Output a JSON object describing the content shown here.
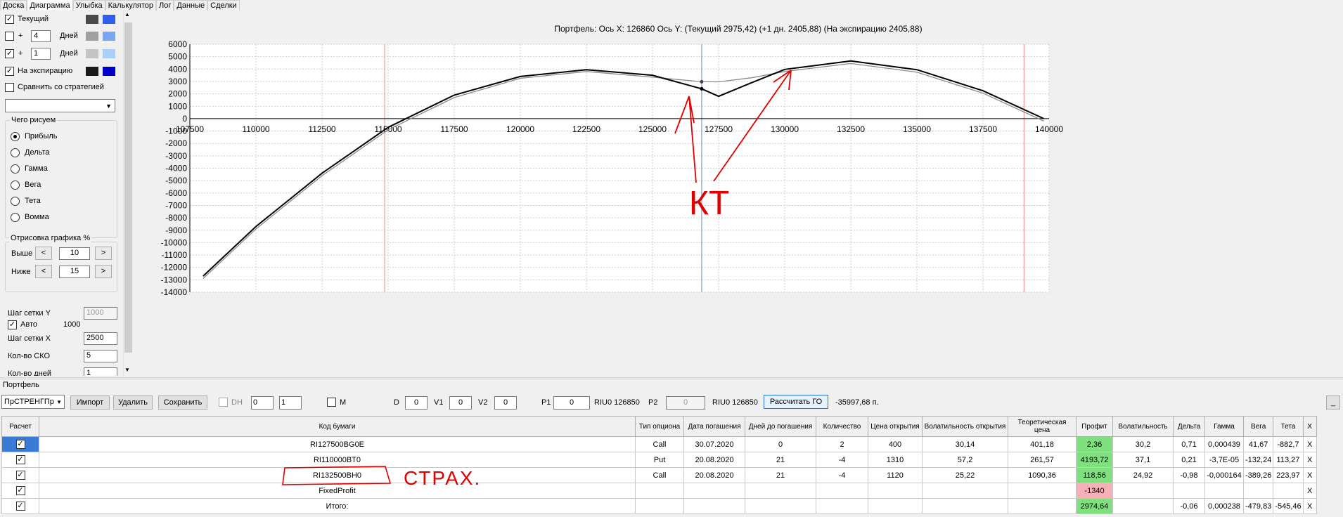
{
  "tabs": [
    "Доска",
    "Диаграмма",
    "Улыбка",
    "Калькулятор",
    "Лог",
    "Данные",
    "Сделки"
  ],
  "left": {
    "tekushiy_label": "Текущий",
    "plus1": "+",
    "days1_value": "4",
    "days1_label": "Дней",
    "plus2": "+",
    "days2_value": "1",
    "days2_label": "Дней",
    "expir_label": "На экспирацию",
    "compare_label": "Сравнить со стратегией",
    "draw_group": "Чего рисуем",
    "options": [
      "Прибыль",
      "Дельта",
      "Гамма",
      "Вега",
      "Тета",
      "Вомма"
    ],
    "render_group": "Отрисовка графика %",
    "higher_label": "Выше",
    "higher_value": "10",
    "lower_label": "Ниже",
    "lower_value": "15",
    "btn_left": "<",
    "btn_right": ">",
    "grid_y_label": "Шаг сетки Y",
    "grid_y_value": "1000",
    "auto_label": "Авто",
    "auto_value": "1000",
    "grid_x_label": "Шаг сетки X",
    "grid_x_value": "2500",
    "sko_label": "Кол-во СКО",
    "sko_value": "5",
    "days_cut_label": "Кол-во дней",
    "days_cut_value": "1"
  },
  "colors": {
    "current": "#4a4a4a",
    "current2": "#2f5ff0",
    "d1": "#a0a0a0",
    "d1b": "#7aa6f0",
    "d2": "#c4c4c4",
    "d2b": "#a8d0f8",
    "exp": "#1a1a1a",
    "expb": "#0000c8",
    "annot": "#e00000"
  },
  "chart_data": {
    "type": "line",
    "title": "Портфель: Ось X: 126860 Ось Y:  (Текущий 2975,42)  (+1 дн. 2405,88)  (На экспирацию 2405,88)",
    "xlim": [
      107500,
      140000
    ],
    "ylim": [
      -14000,
      6000
    ],
    "x_ticks": [
      107500,
      110000,
      112500,
      115000,
      117500,
      120000,
      122500,
      125000,
      127500,
      130000,
      132500,
      135000,
      137500,
      140000
    ],
    "y_ticks": [
      6000,
      5000,
      4000,
      3000,
      2000,
      1000,
      0,
      -1000,
      -2000,
      -3000,
      -4000,
      -5000,
      -6000,
      -7000,
      -8000,
      -9000,
      -10000,
      -11000,
      -12000,
      -13000,
      -14000
    ],
    "cursor_x": 126860,
    "red_lines": [
      114870,
      139050
    ],
    "series": [
      {
        "x": [
          108000,
          110000,
          112500,
          115000,
          117500,
          120000,
          122500,
          125000,
          126860,
          127500,
          128750,
          130000,
          132500,
          135000,
          137500,
          139800
        ],
        "y": [
          -12700,
          -8700,
          -4400,
          -700,
          1900,
          3400,
          3950,
          3500,
          2406,
          1800,
          2900,
          3970,
          4650,
          3950,
          2250,
          0
        ]
      },
      {
        "x": [
          108000,
          110000,
          112500,
          115000,
          117500,
          120000,
          122500,
          125000,
          126860,
          127500,
          128750,
          130000,
          132500,
          135000,
          137500,
          139800
        ],
        "y": [
          -12900,
          -8900,
          -4600,
          -900,
          1700,
          3250,
          3800,
          3350,
          2975,
          2970,
          3300,
          3800,
          4450,
          3750,
          2050,
          -200
        ]
      }
    ],
    "annotation_text": "КТ",
    "point_labels": []
  },
  "portfolio": {
    "title": "Портфель",
    "strategy": "ПрСТРЕНГПр",
    "import": "Импорт",
    "delete": "Удалить",
    "save": "Сохранить",
    "dh": "DH",
    "s1": "0",
    "s2": "1",
    "m": "M",
    "d_label": "D",
    "d_val": "0",
    "v1_label": "V1",
    "v1_val": "0",
    "v2_label": "V2",
    "v2_val": "0",
    "p1_label": "P1",
    "p1_val": "0",
    "p1_code": "RIU0 126850",
    "p2_label": "P2",
    "p2_val": "0",
    "p2_code": "RIU0 126850",
    "calc_go": "Рассчитать ГО",
    "go_value": "-35997,68 п.",
    "min": "_",
    "headers": [
      "Расчет",
      "Код бумаги",
      "Тип опциона",
      "Дата погашения",
      "Дней до погашения",
      "Количество",
      "Цена открытия",
      "Волатильность открытия",
      "Теоретическая цена",
      "Профит",
      "Волатильность",
      "Дельта",
      "Гамма",
      "Вега",
      "Тета",
      "X"
    ],
    "rows": [
      [
        "RI127500BG0E",
        "Call",
        "30.07.2020",
        "0",
        "2",
        "400",
        "30,14",
        "401,18",
        "2,36",
        "30,2",
        "0,71",
        "0,000439",
        "41,67",
        "-882,7",
        "X"
      ],
      [
        "RI110000BT0",
        "Put",
        "20.08.2020",
        "21",
        "-4",
        "1310",
        "57,2",
        "261,57",
        "4193,72",
        "37,1",
        "0,21",
        "-3,7E-05",
        "-132,24",
        "113,27",
        "X"
      ],
      [
        "RI132500BH0",
        "Call",
        "20.08.2020",
        "21",
        "-4",
        "1120",
        "25,22",
        "1090,36",
        "118,56",
        "24,92",
        "-0,98",
        "-0,000164",
        "-389,26",
        "223,97",
        "X"
      ],
      [
        "FixedProfit",
        "",
        "",
        "",
        "",
        "",
        "",
        "",
        "-1340",
        "",
        "",
        "",
        "",
        "",
        "X"
      ],
      [
        "Итого:",
        "",
        "",
        "",
        "",
        "",
        "",
        "",
        "2974,64",
        "",
        "-0,06",
        "0,000238",
        "-479,83",
        "-545,46",
        "X"
      ]
    ],
    "strah": "СТРАХ."
  }
}
